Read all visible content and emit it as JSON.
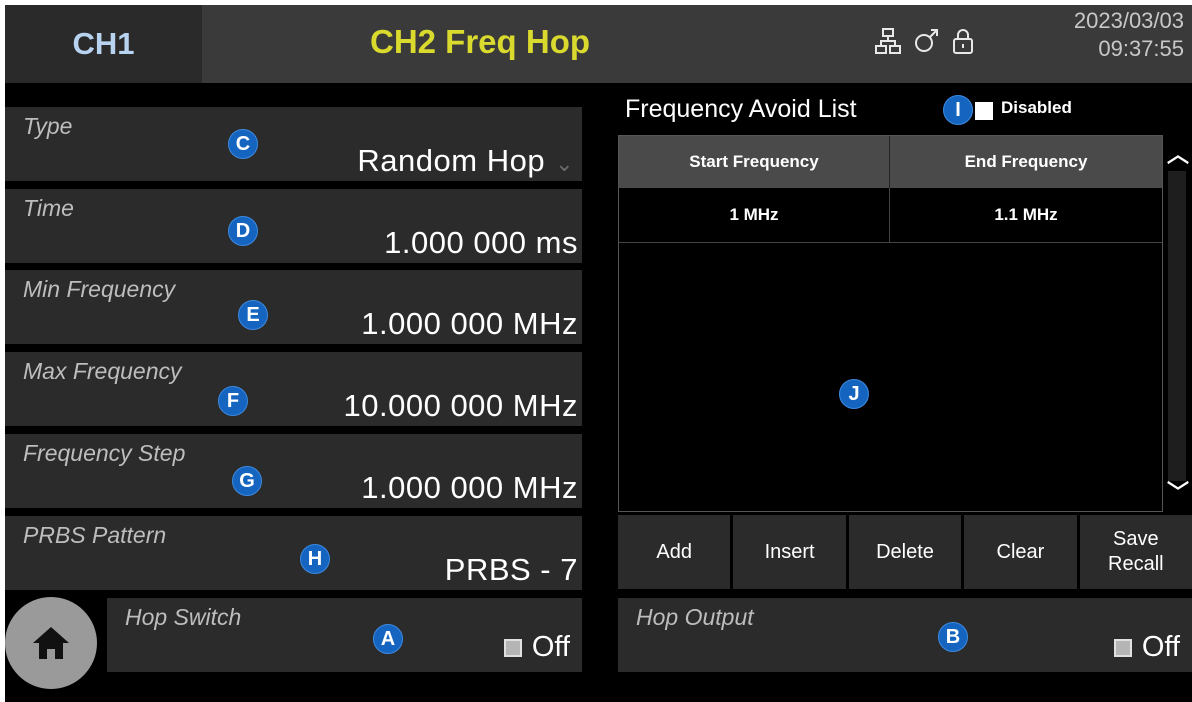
{
  "header": {
    "ch1_tab": "CH1",
    "title": "CH2 Freq Hop",
    "icons": [
      "network-icon",
      "usb-icon",
      "lock-icon"
    ],
    "date": "2023/03/03",
    "time": "09:37:55"
  },
  "params": [
    {
      "name": "type",
      "label": "Type",
      "value": "Random Hop",
      "badge": "C"
    },
    {
      "name": "time",
      "label": "Time",
      "value": "1.000 000 ms",
      "badge": "D"
    },
    {
      "name": "min-frequency",
      "label": "Min Frequency",
      "value": "1.000 000 MHz",
      "badge": "E"
    },
    {
      "name": "max-frequency",
      "label": "Max Frequency",
      "value": "10.000 000 MHz",
      "badge": "F"
    },
    {
      "name": "frequency-step",
      "label": "Frequency Step",
      "value": "1.000 000 MHz",
      "badge": "G"
    },
    {
      "name": "prbs-pattern",
      "label": "PRBS Pattern",
      "value": "PRBS - 7",
      "badge": "H"
    }
  ],
  "avoid": {
    "title": "Frequency Avoid List",
    "badge": "I",
    "state": "Disabled",
    "list_badge": "J",
    "columns": [
      "Start Frequency",
      "End Frequency"
    ],
    "rows": [
      [
        "1 MHz",
        "1.1 MHz"
      ]
    ]
  },
  "buttons": {
    "add": "Add",
    "insert": "Insert",
    "delete": "Delete",
    "clear": "Clear",
    "save_recall_1": "Save",
    "save_recall_2": "Recall"
  },
  "hop_switch": {
    "label": "Hop Switch",
    "badge": "A",
    "state": "Off"
  },
  "hop_output": {
    "label": "Hop Output",
    "badge": "B",
    "state": "Off"
  },
  "colors": {
    "title": "#d9d92e",
    "badge": "#1565c0",
    "ch1": "#b8d3f0"
  }
}
